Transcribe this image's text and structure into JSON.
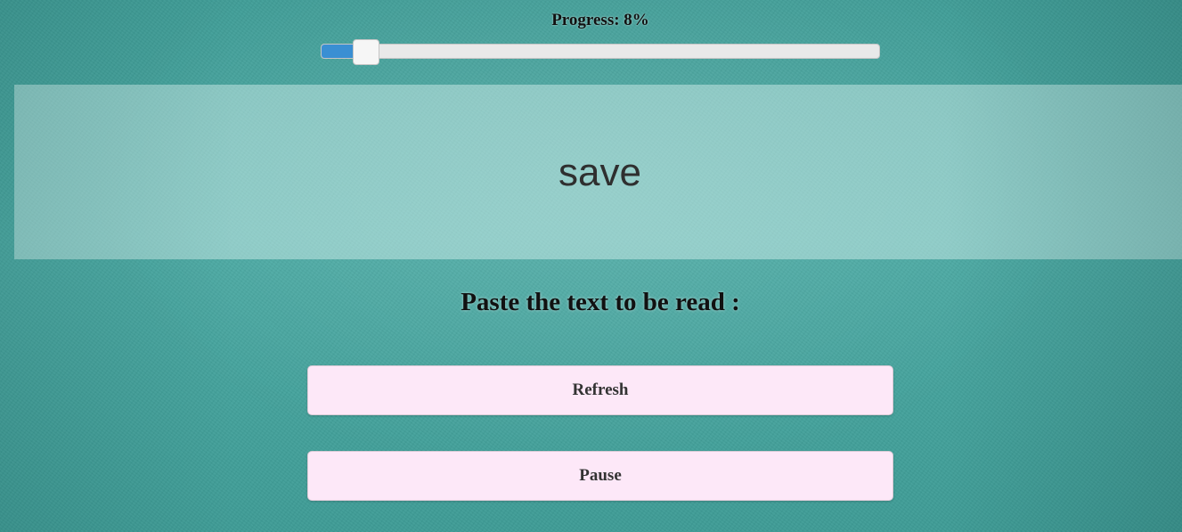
{
  "progress": {
    "label": "Progress: 8%",
    "percent": 8
  },
  "reader": {
    "current_word": "save"
  },
  "prompt": {
    "text": "Paste the text to be read :"
  },
  "buttons": {
    "refresh_label": "Refresh",
    "pause_label": "Pause"
  },
  "colors": {
    "slider_fill": "#3a8fd3",
    "button_bg": "#fde8f8",
    "page_bg": "#45a39d"
  }
}
